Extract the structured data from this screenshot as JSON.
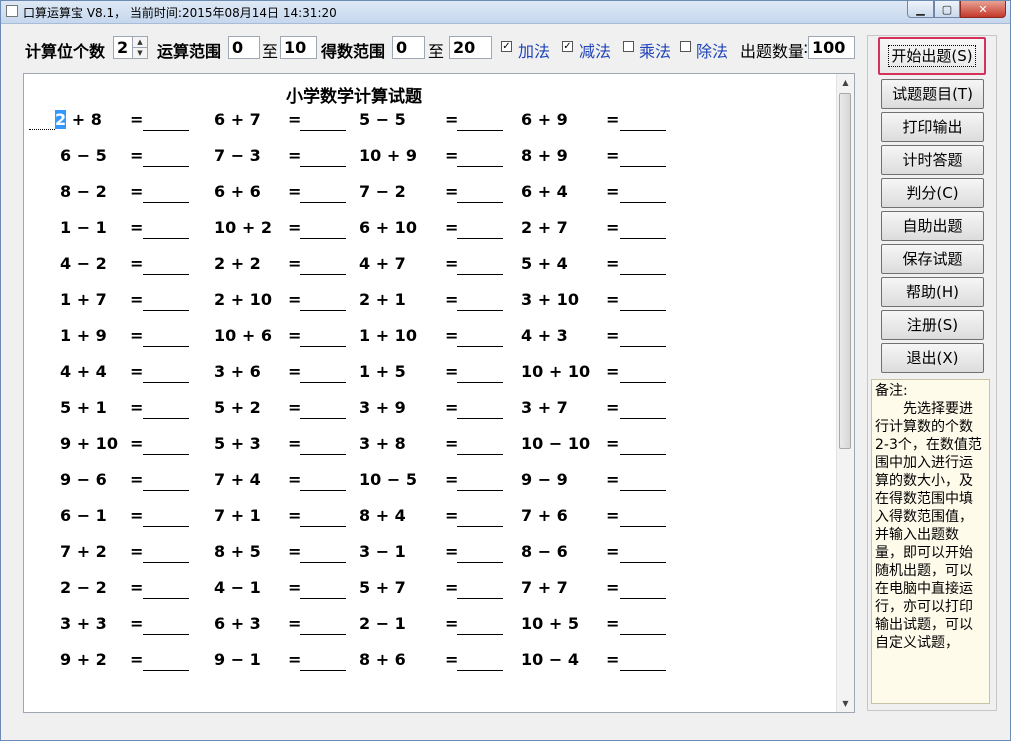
{
  "window": {
    "title": "口算运算宝 V8.1， 当前时间:2015年08月14日 14:31:20"
  },
  "params": {
    "digits_label": "计算位个数",
    "digits_value": "2",
    "range_label": "运算范围",
    "range_from": "0",
    "to1": "至",
    "range_to": "10",
    "result_label": "得数范围",
    "result_from": "0",
    "to2": "至",
    "result_to": "20",
    "ops": [
      {
        "label": "加法",
        "checked": true
      },
      {
        "label": "减法",
        "checked": true
      },
      {
        "label": "乘法",
        "checked": false
      },
      {
        "label": "除法",
        "checked": false
      }
    ],
    "count_label": "出题数量",
    "count_value": "100"
  },
  "paper": {
    "title": "小学数学计算试题",
    "equals": "=",
    "rows": [
      [
        "2 + 8",
        "6 + 7",
        "5 − 5",
        "6 + 9"
      ],
      [
        "6 − 5",
        "7 − 3",
        "10 + 9",
        "8 + 9"
      ],
      [
        "8 − 2",
        "6 + 6",
        "7 − 2",
        "6 + 4"
      ],
      [
        "1 − 1",
        "10 + 2",
        "6 + 10",
        "2 + 7"
      ],
      [
        "4 − 2",
        "2 + 2",
        "4 + 7",
        "5 + 4"
      ],
      [
        "1 + 7",
        "2 + 10",
        "2 + 1",
        "3 + 10"
      ],
      [
        "1 + 9",
        "10 + 6",
        "1 + 10",
        "4 + 3"
      ],
      [
        "4 + 4",
        "3 + 6",
        "1 + 5",
        "10 + 10"
      ],
      [
        "5 + 1",
        "5 + 2",
        "3 + 9",
        "3 + 7"
      ],
      [
        "9 + 10",
        "5 + 3",
        "3 + 8",
        "10 − 10"
      ],
      [
        "9 − 6",
        "7 + 4",
        "10 − 5",
        "9 − 9"
      ],
      [
        "6 − 1",
        "7 + 1",
        "8 + 4",
        "7 + 6"
      ],
      [
        "7 + 2",
        "8 + 5",
        "3 − 1",
        "8 − 6"
      ],
      [
        "2 − 2",
        "4 − 1",
        "5 + 7",
        "7 + 7"
      ],
      [
        "3 + 3",
        "6 + 3",
        "2 − 1",
        "10 + 5"
      ],
      [
        "9 + 2",
        "9 − 1",
        "8 + 6",
        "10 − 4"
      ]
    ]
  },
  "buttons": {
    "start": "开始出题(S)",
    "list": [
      "试题题目(T)",
      "打印输出",
      "计时答题",
      "判分(C)",
      "自助出题",
      "保存试题",
      "帮助(H)",
      "注册(S)",
      "退出(X)"
    ]
  },
  "notes": {
    "title": "备注:",
    "text": "先选择要进行计算数的个数2-3个，在数值范围中加入进行运算的数大小，及在得数范围中填入得数范围值，并输入出题数量，即可以开始随机出题，可以在电脑中直接运行，亦可以打印输出试题，可以自定义试题，"
  }
}
